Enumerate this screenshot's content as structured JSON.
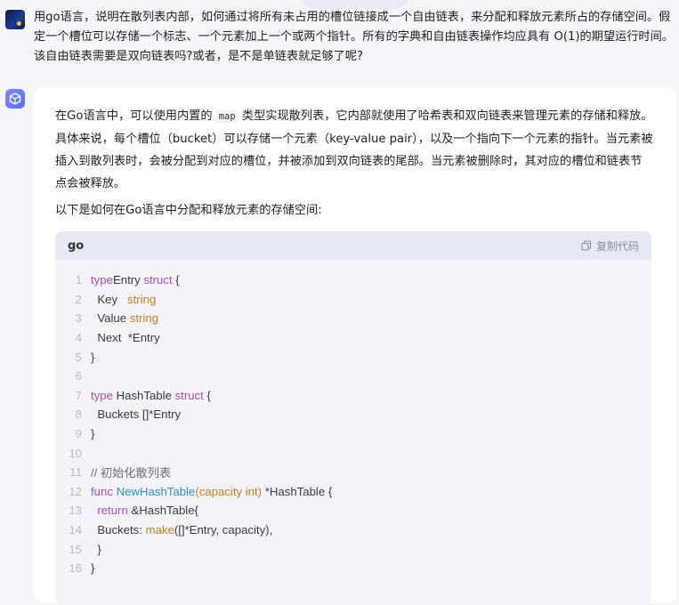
{
  "top_pill": "",
  "user_message": {
    "text": "用go语言，说明在散列表内部，如何通过将所有未占用的槽位链接成一个自由链表，来分配和释放元素所占的存储空间。假定一个槽位可以存储一个标志、一个元素加上一个或两个指针。所有的字典和自由链表操作均应具有 O(1)的期望运行时间。该自由链表需要是双向链表吗?或者，是不是单链表就足够了呢?"
  },
  "answer": {
    "para1_before": "在Go语言中，可以使用内置的 ",
    "para1_code": "map",
    "para1_after": " 类型实现散列表，它内部就使用了哈希表和双向链表来管理元素的存储和释放。具体来说，每个槽位（bucket）可以存储一个元素（key-value pair），以及一个指向下一个元素的指针。当元素被插入到散列表时，会被分配到对应的槽位，并被添加到双向链表的尾部。当元素被删除时，其对应的槽位和链表节点会被释放。",
    "para2": "以下是如何在Go语言中分配和释放元素的存储空间:"
  },
  "code_block": {
    "language": "go",
    "copy_label": "复制代码",
    "lines": [
      {
        "n": "1",
        "tokens": [
          [
            "kw",
            "type"
          ],
          [
            "",
            "Entry "
          ],
          [
            "kw",
            "struct"
          ],
          [
            "",
            " {"
          ]
        ]
      },
      {
        "n": "2",
        "tokens": [
          [
            "",
            "  Key   "
          ],
          [
            "ty",
            "string"
          ]
        ]
      },
      {
        "n": "3",
        "tokens": [
          [
            "",
            "  Value "
          ],
          [
            "ty",
            "string"
          ]
        ]
      },
      {
        "n": "4",
        "tokens": [
          [
            "",
            "  Next  *Entry"
          ]
        ]
      },
      {
        "n": "5",
        "tokens": [
          [
            "",
            "}"
          ]
        ]
      },
      {
        "n": "6",
        "tokens": []
      },
      {
        "n": "7",
        "tokens": [
          [
            "kw",
            "type"
          ],
          [
            "",
            " HashTable "
          ],
          [
            "kw",
            "struct"
          ],
          [
            "",
            " {"
          ]
        ]
      },
      {
        "n": "8",
        "tokens": [
          [
            "",
            "  Buckets []*Entry"
          ]
        ]
      },
      {
        "n": "9",
        "tokens": [
          [
            "",
            "}"
          ]
        ]
      },
      {
        "n": "10",
        "tokens": []
      },
      {
        "n": "11",
        "tokens": [
          [
            "cm",
            "// 初始化散列表"
          ]
        ]
      },
      {
        "n": "12",
        "tokens": [
          [
            "kw",
            "func"
          ],
          [
            "",
            " "
          ],
          [
            "fn",
            "NewHashTable"
          ],
          [
            "ty",
            "(capacity int)"
          ],
          [
            "",
            " *HashTable {"
          ]
        ]
      },
      {
        "n": "13",
        "tokens": [
          [
            "kw",
            "  return"
          ],
          [
            "",
            " &HashTable{"
          ]
        ]
      },
      {
        "n": "14",
        "tokens": [
          [
            "",
            "  Buckets: "
          ],
          [
            "ty",
            "make"
          ],
          [
            "",
            "([]*Entry, capacity),"
          ]
        ]
      },
      {
        "n": "15",
        "tokens": [
          [
            "",
            "  }"
          ]
        ]
      },
      {
        "n": "16",
        "tokens": [
          [
            "",
            "}"
          ]
        ]
      }
    ]
  }
}
